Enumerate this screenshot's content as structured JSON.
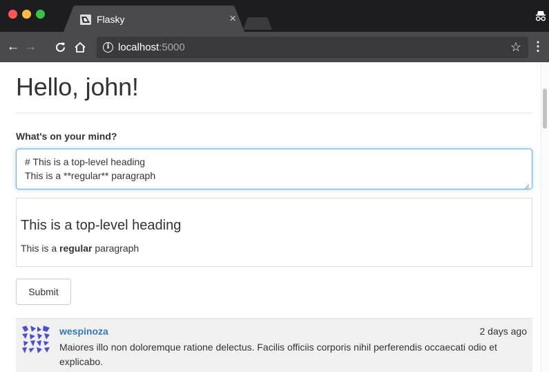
{
  "browser": {
    "tab": {
      "title": "Flasky",
      "close_label": "×"
    },
    "omnibox": {
      "host": "localhost",
      "port": ":5000"
    },
    "icons": {
      "back": "arrow-left-icon",
      "forward": "arrow-right-icon",
      "reload": "reload-icon",
      "home": "home-icon",
      "info": "info-icon",
      "star": "star-icon",
      "menu": "menu-dots-icon",
      "incognito": "incognito-icon"
    },
    "glyphs": {
      "back": "←",
      "forward": "→",
      "reload": "C",
      "home": "⌂",
      "info": "i",
      "star": "☆",
      "menu": "⋮"
    },
    "colors": {
      "close": "#fc5753",
      "minimize": "#fdbc40",
      "maximize": "#33c748"
    }
  },
  "page": {
    "title": "Hello, john!",
    "form": {
      "label": "What's on your mind?",
      "textarea_value": "# This is a top-level heading\nThis is a **regular** paragraph",
      "submit_label": "Submit"
    },
    "preview": {
      "heading": "This is a top-level heading",
      "para_before": "This is a ",
      "para_bold": "regular",
      "para_after": " paragraph"
    },
    "posts": [
      {
        "author": "wespinoza",
        "date": "2 days ago",
        "body": "Maiores illo non doloremque ratione delectus. Facilis officiis corporis nihil perferendis occaecati odio et explicabo."
      }
    ],
    "accent_color": "#337ab7"
  }
}
